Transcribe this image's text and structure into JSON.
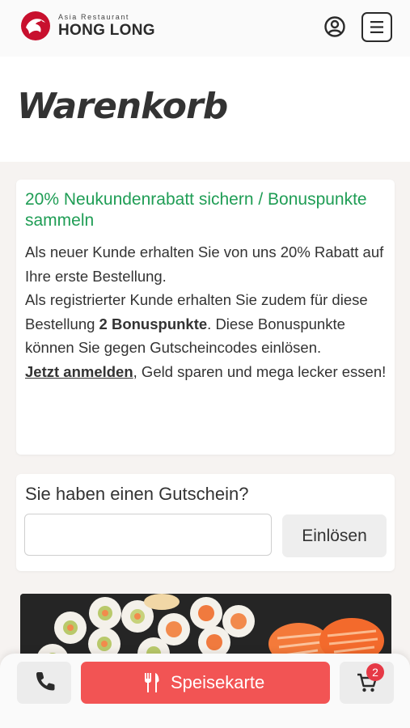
{
  "header": {
    "logo_sub": "Asia Restaurant",
    "logo_name": "HONG LONG",
    "brand_color": "#c8102e",
    "account_icon": "account-circle-icon",
    "menu_icon": "hamburger-menu-icon"
  },
  "page": {
    "title": "Warenkorb"
  },
  "promo": {
    "heading": "20% Neukundenrabatt sichern / Bonuspunkte sammeln",
    "heading_color": "#1f9d55",
    "line1": "Als neuer Kunde erhalten Sie von uns 20% Rabatt auf Ihre erste Bestellung.",
    "line2_start": "Als registrierter Kunde erhalten Sie zudem für diese Bestellung ",
    "bonus_points": "2 Bonuspunkte",
    "line2_end": ". Diese Bonuspunkte können Sie gegen Gutscheincodes einlösen.",
    "login_link": "Jetzt anmelden",
    "line3_end": ", Geld sparen und mega lecker essen!"
  },
  "voucher": {
    "label": "Sie haben einen Gutschein?",
    "input_value": "",
    "redeem_label": "Einlösen"
  },
  "bottom_bar": {
    "phone_icon": "phone-icon",
    "menu_card_label": "Speisekarte",
    "menu_card_icon": "fork-knife-icon",
    "menu_card_color": "#f25454",
    "cart_icon": "shopping-cart-icon",
    "cart_count": "2",
    "badge_color": "#e63946"
  }
}
